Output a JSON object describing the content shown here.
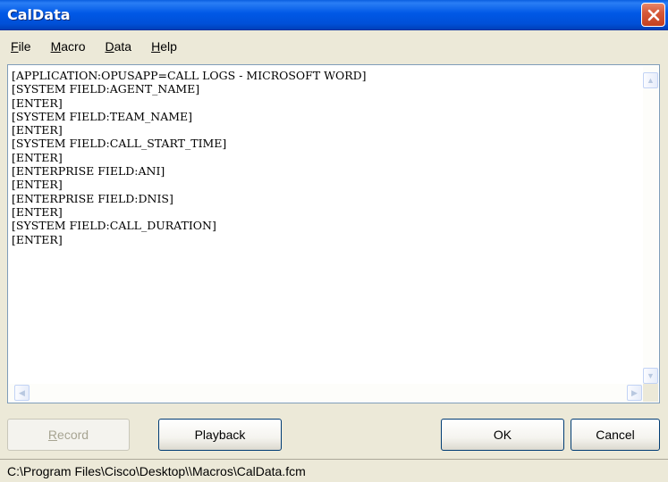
{
  "window": {
    "title": "CalData"
  },
  "menu": {
    "file": {
      "underline": "F",
      "rest": "ile"
    },
    "macro": {
      "underline": "M",
      "rest": "acro"
    },
    "data": {
      "underline": "D",
      "rest": "ata"
    },
    "help": {
      "underline": "H",
      "rest": "elp"
    }
  },
  "editor": {
    "lines": [
      "[APPLICATION:OPUSAPP=CALL LOGS - MICROSOFT WORD]",
      "[SYSTEM FIELD:AGENT_NAME]",
      "[ENTER]",
      "[SYSTEM FIELD:TEAM_NAME]",
      "[ENTER]",
      "[SYSTEM FIELD:CALL_START_TIME]",
      "[ENTER]",
      "[ENTERPRISE FIELD:ANI]",
      "[ENTER]",
      "[ENTERPRISE FIELD:DNIS]",
      "[ENTER]",
      "[SYSTEM FIELD:CALL_DURATION]",
      "[ENTER]"
    ]
  },
  "buttons": {
    "record": {
      "underline": "R",
      "rest": "ecord"
    },
    "playback": "Playback",
    "ok": "OK",
    "cancel": "Cancel"
  },
  "status": {
    "path": "C:\\Program Files\\Cisco\\Desktop\\\\Macros\\CalData.fcm"
  },
  "icons": {
    "close": "close-icon",
    "scroll_up": "arrow-up-icon",
    "scroll_down": "arrow-down-icon",
    "scroll_left": "arrow-left-icon",
    "scroll_right": "arrow-right-icon"
  },
  "colors": {
    "titlebar": "#0058e6",
    "close": "#d65a3a",
    "face": "#ece9d8"
  }
}
